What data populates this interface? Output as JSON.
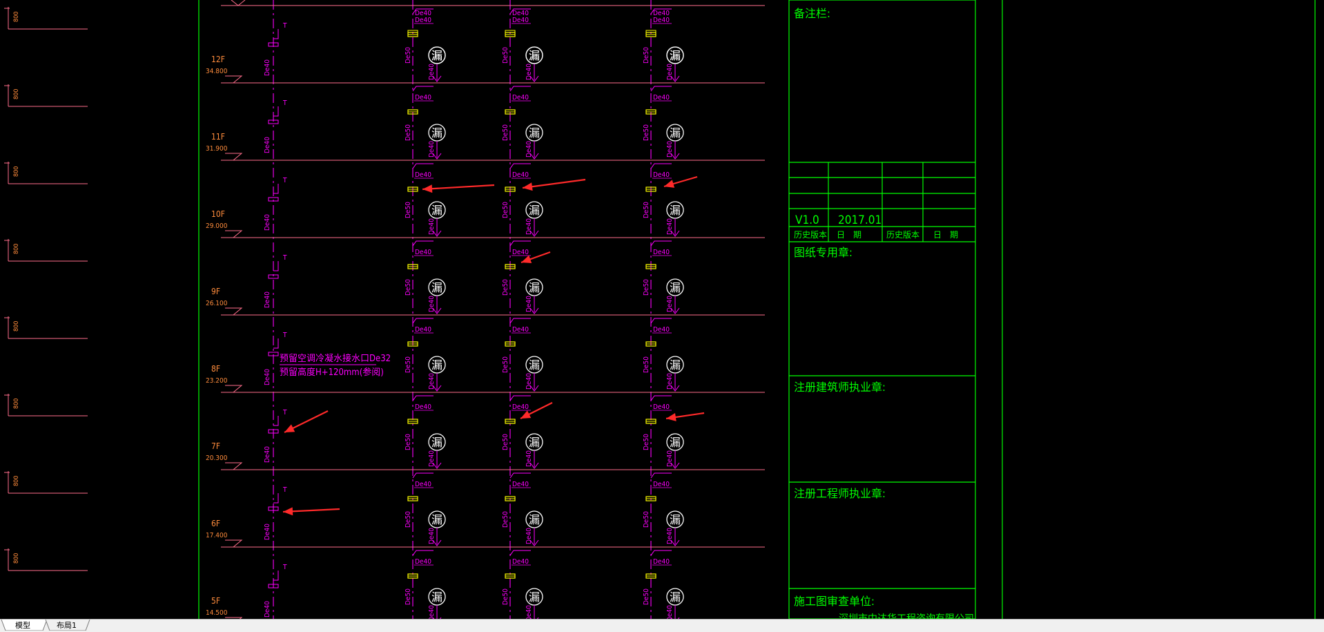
{
  "colors": {
    "background": "#000000",
    "floor_line": "#ff6e8c",
    "pipe": "#ff00ff",
    "fitting": "#ffff00",
    "frame": "#00ff00",
    "annotation_arrow": "#ff2a2a",
    "level_text": "#ff8c3c",
    "title_block_text": "#00ff00",
    "tab_bar": "#f0f0f0"
  },
  "floors": [
    {
      "name": "12F",
      "elevation": "34.800"
    },
    {
      "name": "11F",
      "elevation": "31.900"
    },
    {
      "name": "10F",
      "elevation": "29.000"
    },
    {
      "name": "9F",
      "elevation": "26.100"
    },
    {
      "name": "8F",
      "elevation": "23.200"
    },
    {
      "name": "7F",
      "elevation": "20.300"
    },
    {
      "name": "6F",
      "elevation": "17.400"
    },
    {
      "name": "5F",
      "elevation": "14.500"
    }
  ],
  "left_dimension_text": "800",
  "pipe_labels": {
    "upper": "De40",
    "side": "De50",
    "side_right": "De40",
    "riser": "De40"
  },
  "leak_symbol": "漏",
  "riser_marker": "T",
  "note": {
    "line1": "预留空调冷凝水接水口De32",
    "line2": "预留高度H+120mm(参阅)"
  },
  "title_block": {
    "remarks_label": "备注栏:",
    "version": "V1.0",
    "date": "2017.01",
    "history_headers": [
      "历史版本",
      "日　期",
      "历史版本",
      "日　期"
    ],
    "seal_label": "图纸专用章:",
    "architect_label": "注册建筑师执业章:",
    "engineer_label": "注册工程师执业章:",
    "review_label": "施工图审查单位:",
    "review_text_partial": "深圳市中达华工程咨询有限公司"
  },
  "tabs": [
    {
      "label": "模型",
      "active": true
    },
    {
      "label": "布局1",
      "active": false
    }
  ]
}
